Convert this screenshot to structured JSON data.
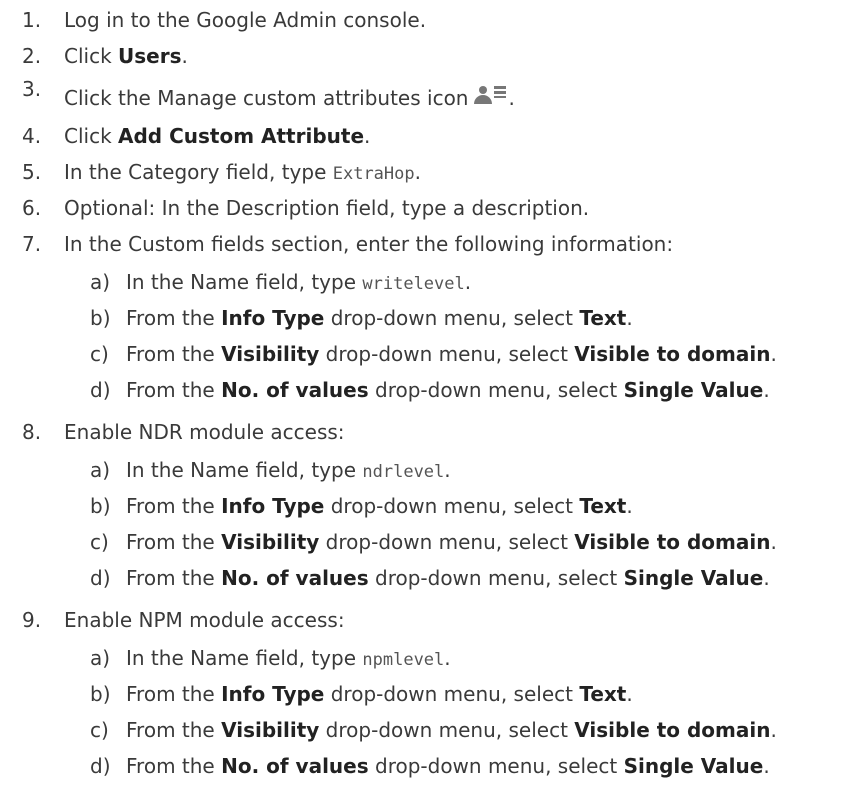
{
  "steps": [
    {
      "num": "1.",
      "parts": [
        {
          "t": "Log in to the Google Admin console."
        }
      ]
    },
    {
      "num": "2.",
      "parts": [
        {
          "t": "Click "
        },
        {
          "t": "Users",
          "b": true
        },
        {
          "t": "."
        }
      ]
    },
    {
      "num": "3.",
      "parts": [
        {
          "t": "Click the Manage custom attributes icon"
        },
        {
          "icon": "manage-custom-attributes-icon"
        },
        {
          "t": "."
        }
      ]
    },
    {
      "num": "4.",
      "parts": [
        {
          "t": "Click "
        },
        {
          "t": "Add Custom Attribute",
          "b": true
        },
        {
          "t": "."
        }
      ]
    },
    {
      "num": "5.",
      "parts": [
        {
          "t": "In the Category field, type "
        },
        {
          "t": "ExtraHop",
          "code": true
        },
        {
          "t": "."
        }
      ]
    },
    {
      "num": "6.",
      "parts": [
        {
          "t": "Optional: In the Description field, type a description."
        }
      ]
    },
    {
      "num": "7.",
      "parts": [
        {
          "t": "In the Custom fields section, enter the following information:"
        }
      ],
      "sub": [
        {
          "let": "a)",
          "parts": [
            {
              "t": "In the Name field, type "
            },
            {
              "t": "writelevel",
              "code": true
            },
            {
              "t": "."
            }
          ]
        },
        {
          "let": "b)",
          "parts": [
            {
              "t": "From the "
            },
            {
              "t": "Info Type",
              "b": true
            },
            {
              "t": " drop-down menu, select "
            },
            {
              "t": "Text",
              "b": true
            },
            {
              "t": "."
            }
          ]
        },
        {
          "let": "c)",
          "parts": [
            {
              "t": "From the "
            },
            {
              "t": "Visibility",
              "b": true
            },
            {
              "t": " drop-down menu, select "
            },
            {
              "t": "Visible to domain",
              "b": true
            },
            {
              "t": "."
            }
          ]
        },
        {
          "let": "d)",
          "parts": [
            {
              "t": "From the "
            },
            {
              "t": "No. of values",
              "b": true
            },
            {
              "t": " drop-down menu, select "
            },
            {
              "t": "Single Value",
              "b": true
            },
            {
              "t": "."
            }
          ]
        }
      ]
    },
    {
      "num": "8.",
      "parts": [
        {
          "t": "Enable NDR module access:"
        }
      ],
      "sub": [
        {
          "let": "a)",
          "parts": [
            {
              "t": "In the Name field, type "
            },
            {
              "t": "ndrlevel",
              "code": true
            },
            {
              "t": "."
            }
          ]
        },
        {
          "let": "b)",
          "parts": [
            {
              "t": "From the "
            },
            {
              "t": "Info Type",
              "b": true
            },
            {
              "t": " drop-down menu, select "
            },
            {
              "t": "Text",
              "b": true
            },
            {
              "t": "."
            }
          ]
        },
        {
          "let": "c)",
          "parts": [
            {
              "t": "From the "
            },
            {
              "t": "Visibility",
              "b": true
            },
            {
              "t": " drop-down menu, select "
            },
            {
              "t": "Visible to domain",
              "b": true
            },
            {
              "t": "."
            }
          ]
        },
        {
          "let": "d)",
          "parts": [
            {
              "t": "From the "
            },
            {
              "t": "No. of values",
              "b": true
            },
            {
              "t": " drop-down menu, select "
            },
            {
              "t": "Single Value",
              "b": true
            },
            {
              "t": "."
            }
          ]
        }
      ]
    },
    {
      "num": "9.",
      "parts": [
        {
          "t": "Enable NPM module access:"
        }
      ],
      "sub": [
        {
          "let": "a)",
          "parts": [
            {
              "t": "In the Name field, type "
            },
            {
              "t": "npmlevel",
              "code": true
            },
            {
              "t": "."
            }
          ]
        },
        {
          "let": "b)",
          "parts": [
            {
              "t": "From the "
            },
            {
              "t": "Info Type",
              "b": true
            },
            {
              "t": " drop-down menu, select "
            },
            {
              "t": "Text",
              "b": true
            },
            {
              "t": "."
            }
          ]
        },
        {
          "let": "c)",
          "parts": [
            {
              "t": "From the "
            },
            {
              "t": "Visibility",
              "b": true
            },
            {
              "t": " drop-down menu, select "
            },
            {
              "t": "Visible to domain",
              "b": true
            },
            {
              "t": "."
            }
          ]
        },
        {
          "let": "d)",
          "parts": [
            {
              "t": "From the "
            },
            {
              "t": "No. of values",
              "b": true
            },
            {
              "t": " drop-down menu, select "
            },
            {
              "t": "Single Value",
              "b": true
            },
            {
              "t": "."
            }
          ]
        }
      ]
    }
  ]
}
